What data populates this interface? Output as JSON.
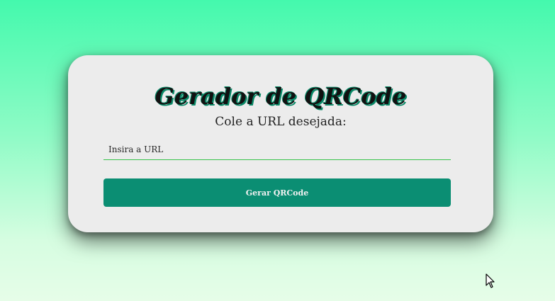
{
  "card": {
    "title": "Gerador de QRCode",
    "subtitle": "Cole a URL desejada:",
    "url_input": {
      "value": "",
      "placeholder": "Insira a URL"
    },
    "generate_button_label": "Gerar QRCode"
  },
  "colors": {
    "background_top": "#44f9ad",
    "background_bottom": "#e6fde8",
    "card": "#ececec",
    "button": "#0b8e73",
    "input_underline": "#38c24a"
  },
  "icons": {
    "cursor": "mouse-pointer-icon"
  }
}
